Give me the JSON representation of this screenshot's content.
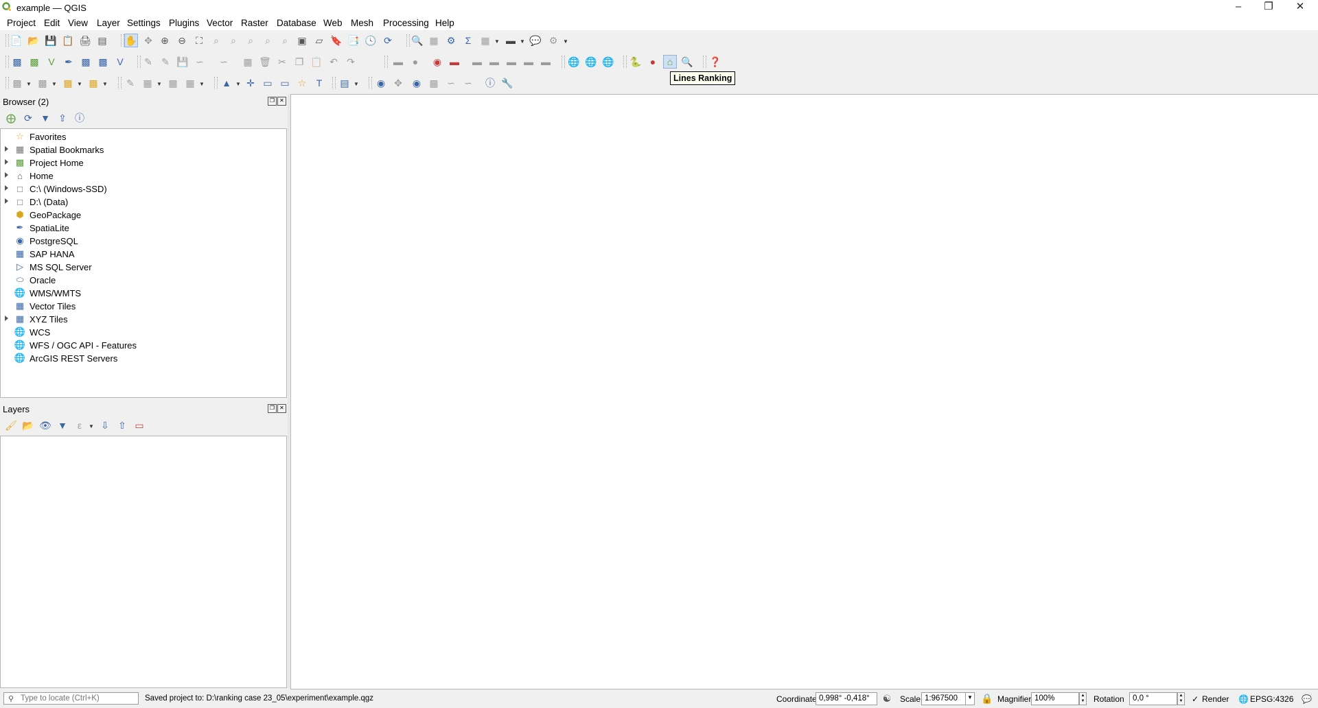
{
  "window": {
    "title": "example — QGIS"
  },
  "menu": {
    "project": "Project",
    "edit": "Edit",
    "view": "View",
    "layer": "Layer",
    "settings": "Settings",
    "plugins": "Plugins",
    "vector": "Vector",
    "raster": "Raster",
    "database": "Database",
    "web": "Web",
    "mesh": "Mesh",
    "processing": "Processing",
    "help": "Help"
  },
  "tooltip": {
    "text": "Lines Ranking"
  },
  "browser": {
    "title": "Browser (2)",
    "items": [
      {
        "label": "Favorites",
        "icon": "star-icon",
        "expandable": false
      },
      {
        "label": "Spatial Bookmarks",
        "icon": "bookmark-icon",
        "expandable": true
      },
      {
        "label": "Project Home",
        "icon": "project-home-icon",
        "expandable": true
      },
      {
        "label": "Home",
        "icon": "home-folder-icon",
        "expandable": true
      },
      {
        "label": "C:\\ (Windows-SSD)",
        "icon": "drive-icon",
        "expandable": true
      },
      {
        "label": "D:\\ (Data)",
        "icon": "drive-icon",
        "expandable": true
      },
      {
        "label": "GeoPackage",
        "icon": "geopackage-icon",
        "expandable": false
      },
      {
        "label": "SpatiaLite",
        "icon": "spatialite-icon",
        "expandable": false
      },
      {
        "label": "PostgreSQL",
        "icon": "postgresql-icon",
        "expandable": false
      },
      {
        "label": "SAP HANA",
        "icon": "sap-hana-icon",
        "expandable": false
      },
      {
        "label": "MS SQL Server",
        "icon": "mssql-icon",
        "expandable": false
      },
      {
        "label": "Oracle",
        "icon": "oracle-icon",
        "expandable": false
      },
      {
        "label": "WMS/WMTS",
        "icon": "wms-icon",
        "expandable": false
      },
      {
        "label": "Vector Tiles",
        "icon": "vector-tiles-icon",
        "expandable": false
      },
      {
        "label": "XYZ Tiles",
        "icon": "xyz-tiles-icon",
        "expandable": true
      },
      {
        "label": "WCS",
        "icon": "wcs-icon",
        "expandable": false
      },
      {
        "label": "WFS / OGC API - Features",
        "icon": "wfs-icon",
        "expandable": false
      },
      {
        "label": "ArcGIS REST Servers",
        "icon": "arcgis-icon",
        "expandable": false
      }
    ]
  },
  "layers": {
    "title": "Layers"
  },
  "status": {
    "locator_placeholder": "Type to locate (Ctrl+K)",
    "message": "Saved project to: D:\\ranking case 23_05\\experiment\\example.qgz",
    "coordinate_label": "Coordinate",
    "coordinate_value": "0,998° -0,418°",
    "scale_label": "Scale",
    "scale_value": "1:967500",
    "magnifier_label": "Magnifier",
    "magnifier_value": "100%",
    "rotation_label": "Rotation",
    "rotation_value": "0,0 °",
    "render_label": "Render",
    "crs": "EPSG:4326"
  },
  "colors": {
    "accent": "#5a9e3a",
    "tooltip_bg": "#fffff0"
  }
}
